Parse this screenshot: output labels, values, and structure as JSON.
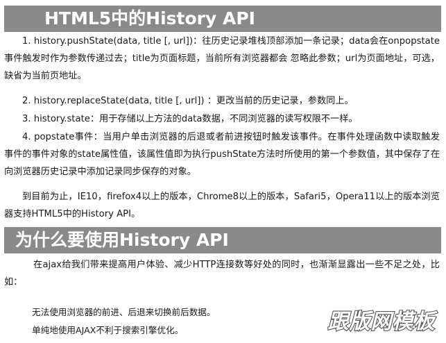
{
  "title": "HTML5中的History API",
  "items": [
    "1. history.pushState(data, title [, url])：往历史记录堆栈顶部添加一条记录；data会在onpopstate事件触发时作为参数传递过去；title为页面标题，当前所有浏览器都会 忽略此参数；url为页面地址，可选，缺省为当前页地址。",
    "2. history.replaceState(data, title [, url]) ：更改当前的历史记录，参数同上。",
    "3. history.state：用于存储以上方法的data数据，不同浏览器的读写权限不一样。",
    "4. popstate事件：当用户单击浏览器的后退或者前进按钮时触发该事件。在事件处理函数中读取触发事件的事件对象的state属性值，该属性值即为执行pushState方法时所使用的第一个参数值，其中保存了在向浏览器历史记录中添加记录同步保存的对象。"
  ],
  "support": "到目前为止，IE10，firefox4以上的版本，Chrome8以上的版本，Safari5，Opera11以上的版本浏览器支持HTML5中的History API。",
  "section2_title": "为什么要使用History API",
  "intro": "在ajax给我们带来提高用户体验、减少HTTP连接数等好处的同时，也渐渐显露出一些不足之处，比如：",
  "bullets": [
    "无法使用浏览器的前进、后退来切换前后数据。",
    "单纯地使用AJAX不利于搜索引擎优化。"
  ],
  "watermark": "跟版网模板"
}
